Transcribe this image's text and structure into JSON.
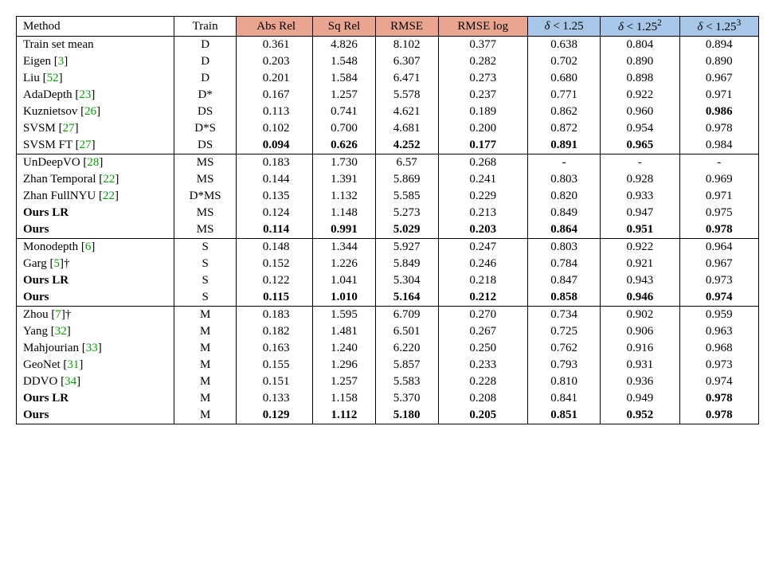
{
  "chart_data": {
    "type": "table",
    "columns": [
      "Method",
      "Train",
      "Abs Rel",
      "Sq Rel",
      "RMSE",
      "RMSE log",
      "δ < 1.25",
      "δ < 1.25²",
      "δ < 1.25³"
    ],
    "column_groups": {
      "lower_is_better": [
        "Abs Rel",
        "Sq Rel",
        "RMSE",
        "RMSE log"
      ],
      "higher_is_better": [
        "δ < 1.25",
        "δ < 1.25²",
        "δ < 1.25³"
      ]
    },
    "groups": [
      {
        "rows": [
          {
            "method": "Train set mean",
            "cite": null,
            "train": "D",
            "abs_rel": "0.361",
            "sq_rel": "4.826",
            "rmse": "8.102",
            "rmse_log": "0.377",
            "d1": "0.638",
            "d2": "0.804",
            "d3": "0.894"
          },
          {
            "method": "Eigen",
            "cite": "3",
            "train": "D",
            "abs_rel": "0.203",
            "sq_rel": "1.548",
            "rmse": "6.307",
            "rmse_log": "0.282",
            "d1": "0.702",
            "d2": "0.890",
            "d3": "0.890"
          },
          {
            "method": "Liu",
            "cite": "52",
            "train": "D",
            "abs_rel": "0.201",
            "sq_rel": "1.584",
            "rmse": "6.471",
            "rmse_log": "0.273",
            "d1": "0.680",
            "d2": "0.898",
            "d3": "0.967"
          },
          {
            "method": "AdaDepth",
            "cite": "23",
            "train": "D*",
            "abs_rel": "0.167",
            "sq_rel": "1.257",
            "rmse": "5.578",
            "rmse_log": "0.237",
            "d1": "0.771",
            "d2": "0.922",
            "d3": "0.971"
          },
          {
            "method": "Kuznietsov",
            "cite": "26",
            "train": "DS",
            "abs_rel": "0.113",
            "sq_rel": "0.741",
            "rmse": "4.621",
            "rmse_log": "0.189",
            "d1": "0.862",
            "d2": "0.960",
            "d3": "0.986",
            "bold": [
              "d3"
            ]
          },
          {
            "method": "SVSM",
            "cite": "27",
            "train": "D*S",
            "abs_rel": "0.102",
            "sq_rel": "0.700",
            "rmse": "4.681",
            "rmse_log": "0.200",
            "d1": "0.872",
            "d2": "0.954",
            "d3": "0.978"
          },
          {
            "method": "SVSM FT",
            "cite": "27",
            "train": "DS",
            "abs_rel": "0.094",
            "sq_rel": "0.626",
            "rmse": "4.252",
            "rmse_log": "0.177",
            "d1": "0.891",
            "d2": "0.965",
            "d3": "0.984",
            "bold": [
              "abs_rel",
              "sq_rel",
              "rmse",
              "rmse_log",
              "d1",
              "d2"
            ]
          }
        ]
      },
      {
        "rows": [
          {
            "method": "UnDeepVO",
            "cite": "28",
            "train": "MS",
            "abs_rel": "0.183",
            "sq_rel": "1.730",
            "rmse": "6.57",
            "rmse_log": "0.268",
            "d1": "-",
            "d2": "-",
            "d3": "-"
          },
          {
            "method": "Zhan Temporal",
            "cite": "22",
            "train": "MS",
            "abs_rel": "0.144",
            "sq_rel": "1.391",
            "rmse": "5.869",
            "rmse_log": "0.241",
            "d1": "0.803",
            "d2": "0.928",
            "d3": "0.969"
          },
          {
            "method": "Zhan FullNYU",
            "cite": "22",
            "train": "D*MS",
            "abs_rel": "0.135",
            "sq_rel": "1.132",
            "rmse": "5.585",
            "rmse_log": "0.229",
            "d1": "0.820",
            "d2": "0.933",
            "d3": "0.971"
          },
          {
            "method": "Ours LR",
            "method_bold": true,
            "train": "MS",
            "abs_rel": "0.124",
            "sq_rel": "1.148",
            "rmse": "5.273",
            "rmse_log": "0.213",
            "d1": "0.849",
            "d2": "0.947",
            "d3": "0.975"
          },
          {
            "method": "Ours",
            "method_bold": true,
            "train": "MS",
            "abs_rel": "0.114",
            "sq_rel": "0.991",
            "rmse": "5.029",
            "rmse_log": "0.203",
            "d1": "0.864",
            "d2": "0.951",
            "d3": "0.978",
            "bold": [
              "abs_rel",
              "sq_rel",
              "rmse",
              "rmse_log",
              "d1",
              "d2",
              "d3"
            ]
          }
        ]
      },
      {
        "rows": [
          {
            "method": "Monodepth",
            "cite": "6",
            "train": "S",
            "abs_rel": "0.148",
            "sq_rel": "1.344",
            "rmse": "5.927",
            "rmse_log": "0.247",
            "d1": "0.803",
            "d2": "0.922",
            "d3": "0.964"
          },
          {
            "method": "Garg",
            "cite": "5",
            "dagger": true,
            "train": "S",
            "abs_rel": "0.152",
            "sq_rel": "1.226",
            "rmse": "5.849",
            "rmse_log": "0.246",
            "d1": "0.784",
            "d2": "0.921",
            "d3": "0.967"
          },
          {
            "method": "Ours LR",
            "method_bold": true,
            "train": "S",
            "abs_rel": "0.122",
            "sq_rel": "1.041",
            "rmse": "5.304",
            "rmse_log": "0.218",
            "d1": "0.847",
            "d2": "0.943",
            "d3": "0.973"
          },
          {
            "method": "Ours",
            "method_bold": true,
            "train": "S",
            "abs_rel": "0.115",
            "sq_rel": "1.010",
            "rmse": "5.164",
            "rmse_log": "0.212",
            "d1": "0.858",
            "d2": "0.946",
            "d3": "0.974",
            "bold": [
              "abs_rel",
              "sq_rel",
              "rmse",
              "rmse_log",
              "d1",
              "d2",
              "d3"
            ]
          }
        ]
      },
      {
        "rows": [
          {
            "method": "Zhou",
            "cite": "7",
            "dagger": true,
            "train": "M",
            "abs_rel": "0.183",
            "sq_rel": "1.595",
            "rmse": "6.709",
            "rmse_log": "0.270",
            "d1": "0.734",
            "d2": "0.902",
            "d3": "0.959"
          },
          {
            "method": "Yang",
            "cite": "32",
            "train": "M",
            "abs_rel": "0.182",
            "sq_rel": "1.481",
            "rmse": "6.501",
            "rmse_log": "0.267",
            "d1": "0.725",
            "d2": "0.906",
            "d3": "0.963"
          },
          {
            "method": "Mahjourian",
            "cite": "33",
            "train": "M",
            "abs_rel": "0.163",
            "sq_rel": "1.240",
            "rmse": "6.220",
            "rmse_log": "0.250",
            "d1": "0.762",
            "d2": "0.916",
            "d3": "0.968"
          },
          {
            "method": "GeoNet",
            "cite": "31",
            "train": "M",
            "abs_rel": "0.155",
            "sq_rel": "1.296",
            "rmse": "5.857",
            "rmse_log": "0.233",
            "d1": "0.793",
            "d2": "0.931",
            "d3": "0.973"
          },
          {
            "method": "DDVO",
            "cite": "34",
            "train": "M",
            "abs_rel": "0.151",
            "sq_rel": "1.257",
            "rmse": "5.583",
            "rmse_log": "0.228",
            "d1": "0.810",
            "d2": "0.936",
            "d3": "0.974"
          },
          {
            "method": "Ours LR",
            "method_bold": true,
            "train": "M",
            "abs_rel": "0.133",
            "sq_rel": "1.158",
            "rmse": "5.370",
            "rmse_log": "0.208",
            "d1": "0.841",
            "d2": "0.949",
            "d3": "0.978",
            "bold": [
              "d3"
            ]
          },
          {
            "method": "Ours",
            "method_bold": true,
            "train": "M",
            "abs_rel": "0.129",
            "sq_rel": "1.112",
            "rmse": "5.180",
            "rmse_log": "0.205",
            "d1": "0.851",
            "d2": "0.952",
            "d3": "0.978",
            "bold": [
              "abs_rel",
              "sq_rel",
              "rmse",
              "rmse_log",
              "d1",
              "d2",
              "d3"
            ]
          }
        ]
      }
    ]
  },
  "header": {
    "method": "Method",
    "train": "Train",
    "abs_rel": "Abs Rel",
    "sq_rel": "Sq Rel",
    "rmse": "RMSE",
    "rmse_log": "RMSE log",
    "d1_html": "<span class='delta'>δ</span> &lt; 1.25",
    "d2_html": "<span class='delta'>δ</span> &lt; 1.25<sup>2</sup>",
    "d3_html": "<span class='delta'>δ</span> &lt; 1.25<sup>3</sup>"
  }
}
